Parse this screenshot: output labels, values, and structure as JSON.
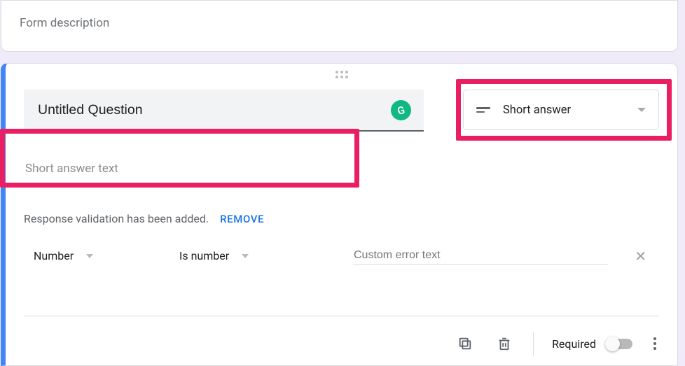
{
  "form": {
    "description_placeholder": "Form description"
  },
  "question": {
    "title": "Untitled Question",
    "type_label": "Short answer",
    "answer_placeholder": "Short answer text"
  },
  "validation": {
    "message": "Response validation has been added.",
    "remove_label": "REMOVE",
    "type": "Number",
    "condition": "Is number",
    "error_placeholder": "Custom error text"
  },
  "footer": {
    "required_label": "Required"
  },
  "grammarly_badge": "G"
}
